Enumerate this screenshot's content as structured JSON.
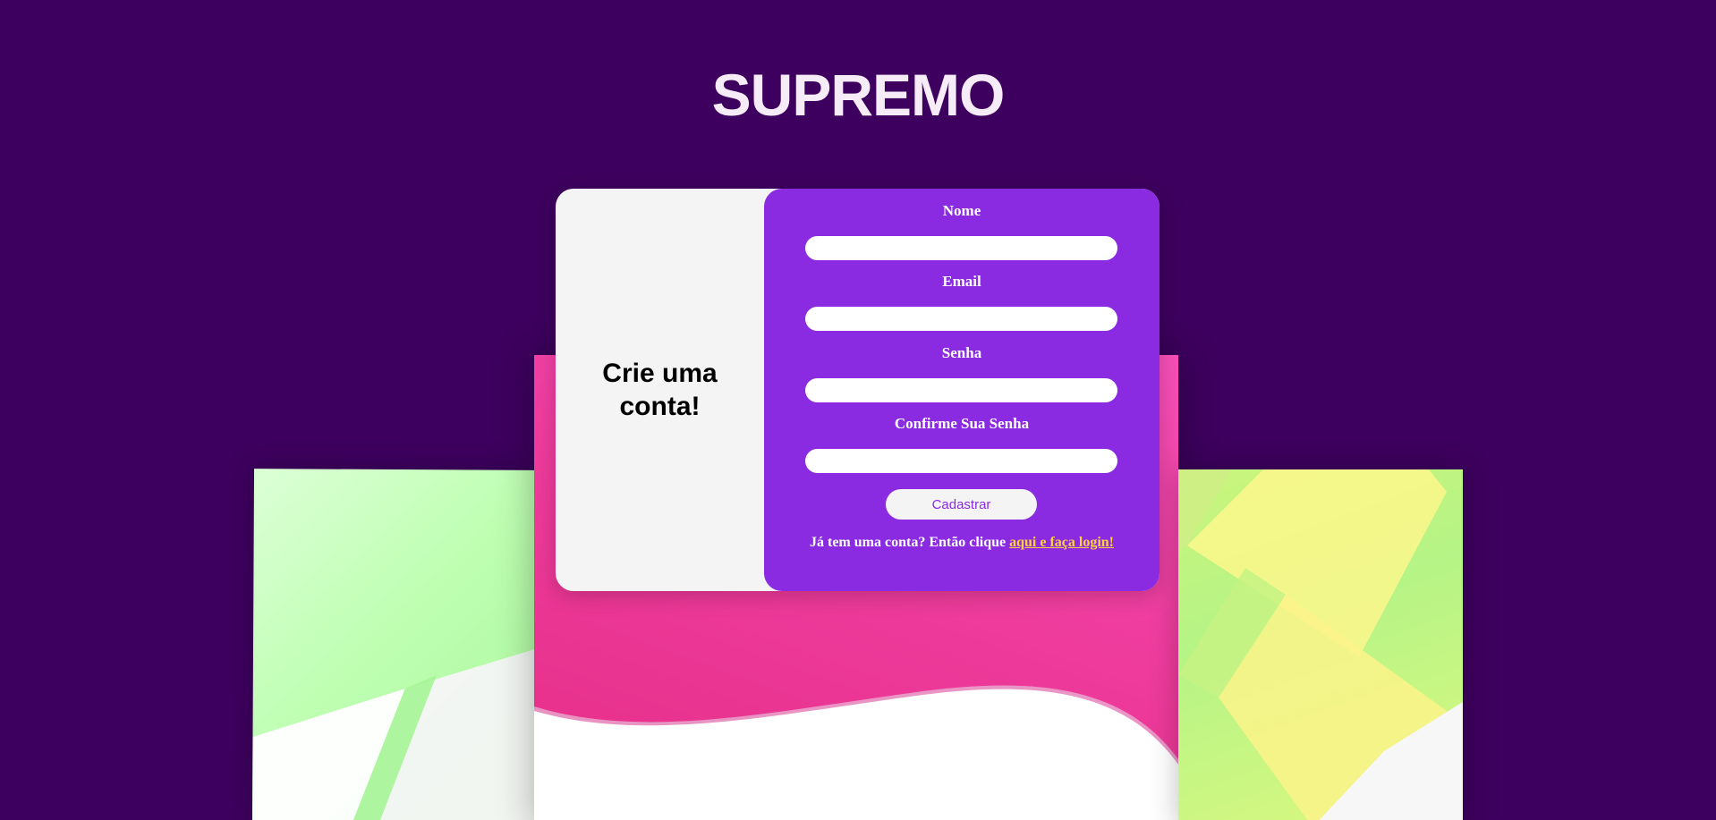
{
  "page": {
    "title": "SUPREMO"
  },
  "card": {
    "heading": "Crie uma conta!"
  },
  "form": {
    "fields": [
      {
        "label": "Nome",
        "value": "",
        "placeholder": ""
      },
      {
        "label": "Email",
        "value": "",
        "placeholder": ""
      },
      {
        "label": "Senha",
        "value": "",
        "placeholder": ""
      },
      {
        "label": "Confirme Sua Senha",
        "value": "",
        "placeholder": ""
      }
    ],
    "submit_label": "Cadastrar",
    "login_prompt": "Já tem uma conta? Então clique ",
    "login_link": "aqui e faça login!"
  },
  "colors": {
    "background": "#3d005e",
    "form_panel": "#8a2be2",
    "card": "#f4f4f4",
    "link": "#ffd23a",
    "accent_pink": "#ef3d9f",
    "accent_green": "#b5f486"
  }
}
